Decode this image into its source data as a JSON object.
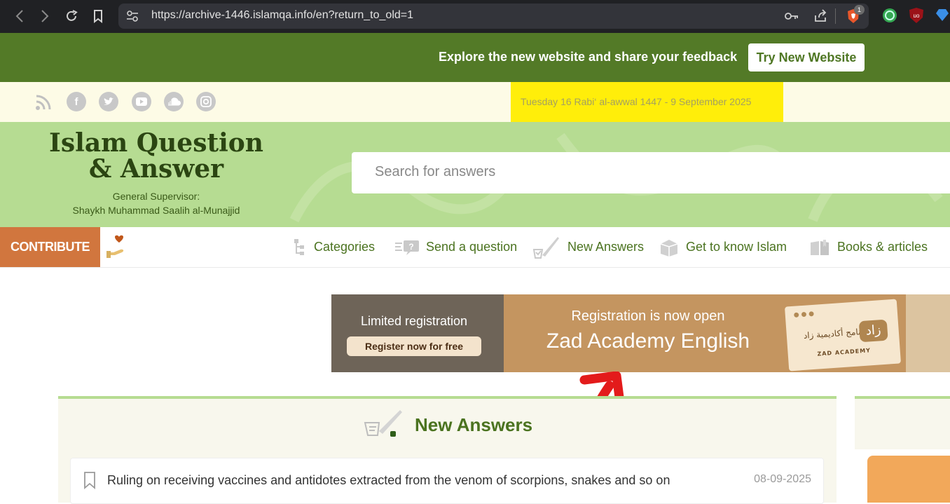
{
  "browser": {
    "url": "https://archive-1446.islamqa.info/en?return_to_old=1",
    "ext_badge_count": "1"
  },
  "banner": {
    "text": "Explore the new website and share your feedback",
    "button": "Try New Website"
  },
  "social": {
    "icons": [
      "rss-icon",
      "facebook-icon",
      "twitter-icon",
      "youtube-icon",
      "soundcloud-icon",
      "instagram-icon"
    ],
    "date": "Tuesday 16 Rabi‘ al-awwal 1447 - 9 September 2025"
  },
  "logo": {
    "title_line1": "Islam Question",
    "title_line2": "& Answer",
    "sub_line1": "General Supervisor:",
    "sub_line2": "Shaykh Muhammad Saalih al-Munajjid"
  },
  "search": {
    "placeholder": "Search for answers"
  },
  "menu": {
    "contribute": "CONTRIBUTE",
    "items": [
      {
        "label": "Categories"
      },
      {
        "label": "Send a question"
      },
      {
        "label": "New Answers"
      },
      {
        "label": "Get to know Islam"
      },
      {
        "label": "Books & articles"
      }
    ]
  },
  "ad": {
    "limited": "Limited registration",
    "button": "Register now for free",
    "headline": "Registration is now open",
    "title": "Zad Academy English",
    "card_arabic": "برنامج أكاديمية زاد",
    "card_name": "ZAD ACADEMY",
    "card_mark": "زاد"
  },
  "new_answers": {
    "title": "New Answers",
    "rows": [
      {
        "text": "Ruling on receiving vaccines and antidotes extracted from the venom of scorpions, snakes and so on",
        "date": "08-09-2025"
      }
    ]
  },
  "colors": {
    "banner_green": "#537a27",
    "hero_green": "#b6dc92",
    "contribute_orange": "#d1763e",
    "date_highlight": "#ffee0a",
    "annotation_arrow": "#e31b1b"
  }
}
